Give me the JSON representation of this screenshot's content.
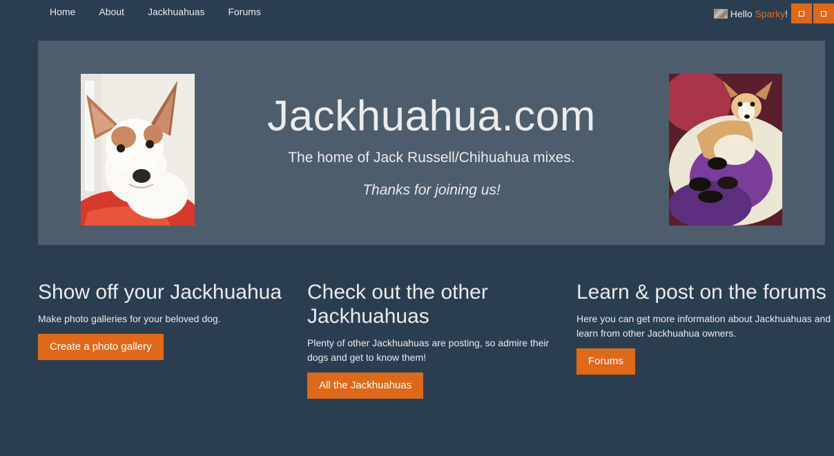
{
  "navbar": {
    "links": [
      "Home",
      "About",
      "Jackhuahuas",
      "Forums"
    ],
    "greeting": "Hello",
    "user_name": "Sparky",
    "exclaim": "!"
  },
  "hero": {
    "title": "Jackhuahua.com",
    "subtitle": "The home of Jack Russell/Chihuahua mixes.",
    "thanks": "Thanks for joining us!"
  },
  "columns": [
    {
      "heading": "Show off your Jackhuahua",
      "text": "Make photo galleries for your beloved dog.",
      "button": "Create a photo gallery"
    },
    {
      "heading": "Check out the other Jackhuahuas",
      "text": "Plenty of other Jackhuahuas are posting, so admire their dogs and get to know them!",
      "button": "All the Jackhuahuas"
    },
    {
      "heading": "Learn & post on the forums",
      "text": "Here you can get more information about Jackhuahuas and learn from other Jackhuahua owners.",
      "button": "Forums"
    }
  ],
  "colors": {
    "background": "#2b3e50",
    "hero_panel": "#4e5d6c",
    "accent": "#df691a",
    "text": "#ebebeb"
  },
  "icons": [
    "user-avatar-image",
    "square-icon",
    "square-icon"
  ]
}
